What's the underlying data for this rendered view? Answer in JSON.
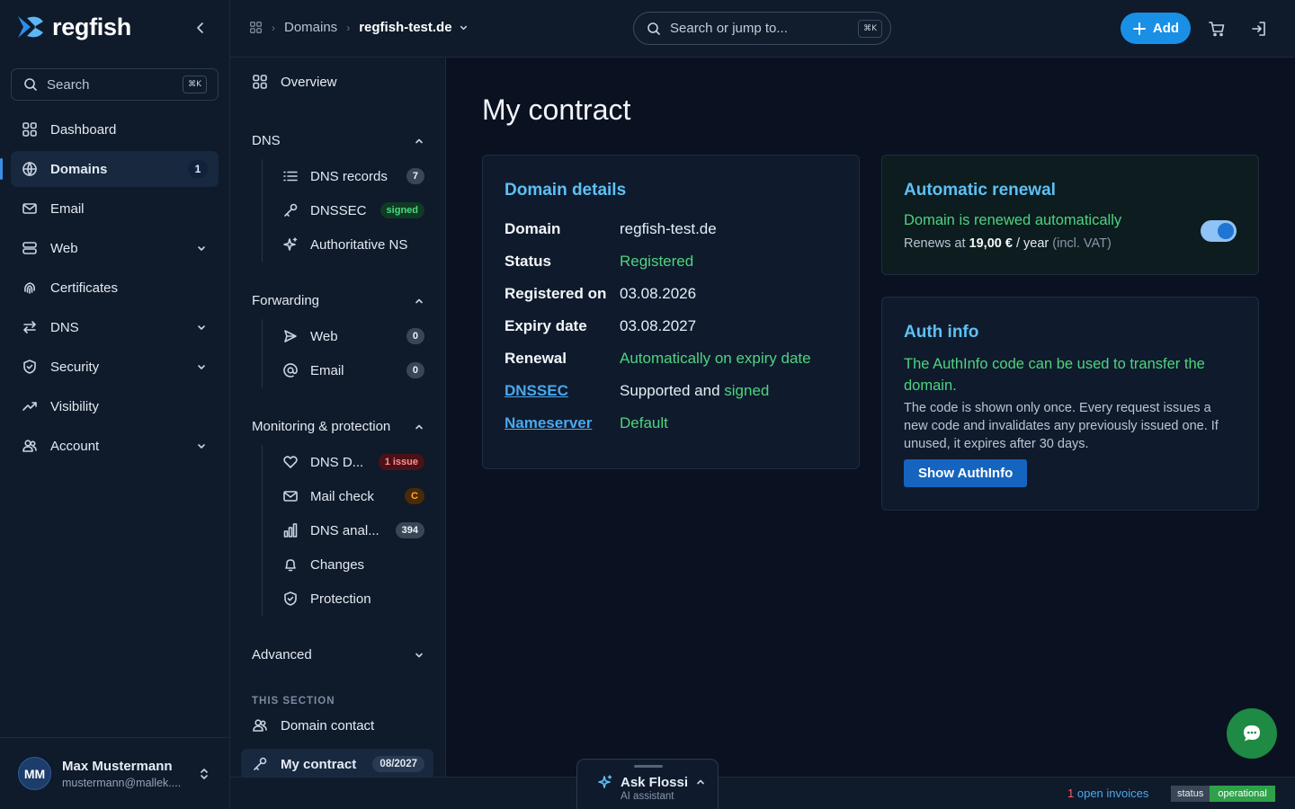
{
  "app": {
    "name": "regfish",
    "brand_color": "#1a8fe6"
  },
  "sidebar": {
    "search": {
      "label": "Search",
      "shortcut": "⌘K"
    },
    "items": [
      {
        "label": "Dashboard",
        "icon": "grid-icon"
      },
      {
        "label": "Domains",
        "icon": "globe-icon",
        "count": "1",
        "active": true
      },
      {
        "label": "Email",
        "icon": "mail-icon"
      },
      {
        "label": "Web",
        "icon": "server-icon",
        "expandable": true
      },
      {
        "label": "Certificates",
        "icon": "fingerprint-icon"
      },
      {
        "label": "DNS",
        "icon": "arrows-icon",
        "expandable": true
      },
      {
        "label": "Security",
        "icon": "shield-icon",
        "expandable": true
      },
      {
        "label": "Visibility",
        "icon": "trend-icon"
      },
      {
        "label": "Account",
        "icon": "users-icon",
        "expandable": true
      }
    ],
    "user": {
      "initials": "MM",
      "name": "Max Mustermann",
      "email": "mustermann@mallek...."
    }
  },
  "topbar": {
    "breadcrumb": [
      "Domains",
      "regfish-test.de"
    ],
    "search_placeholder": "Search or jump to...",
    "search_shortcut": "⌘K",
    "add_label": "Add"
  },
  "subnav": {
    "overview": "Overview",
    "dns": {
      "title": "DNS",
      "items": [
        {
          "label": "DNS records",
          "badge": "7"
        },
        {
          "label": "DNSSEC",
          "badge": "signed"
        },
        {
          "label": "Authoritative NS"
        }
      ]
    },
    "forwarding": {
      "title": "Forwarding",
      "items": [
        {
          "label": "Web",
          "badge": "0"
        },
        {
          "label": "Email",
          "badge": "0"
        }
      ]
    },
    "monitoring": {
      "title": "Monitoring & protection",
      "items": [
        {
          "label": "DNS D...",
          "badge": "1 issue"
        },
        {
          "label": "Mail check",
          "badge": "C"
        },
        {
          "label": "DNS anal...",
          "badge": "394"
        },
        {
          "label": "Changes"
        },
        {
          "label": "Protection"
        }
      ]
    },
    "advanced": {
      "title": "Advanced"
    },
    "this_section": "THIS SECTION",
    "domain_contact": "Domain contact",
    "my_contract": {
      "label": "My contract",
      "badge": "08/2027"
    }
  },
  "main": {
    "title": "My contract",
    "domain_details": {
      "title": "Domain details",
      "rows": [
        {
          "key": "Domain",
          "value": "regfish-test.de"
        },
        {
          "key": "Status",
          "value": "Registered"
        },
        {
          "key": "Registered on",
          "value": "03.08.2026"
        },
        {
          "key": "Expiry date",
          "value": "03.08.2027"
        },
        {
          "key": "Renewal",
          "value": "Automatically on expiry date"
        },
        {
          "key": "DNSSEC",
          "value_prefix": "Supported and ",
          "value_suffix": "signed"
        },
        {
          "key": "Nameserver",
          "value": "Default"
        }
      ]
    },
    "renewal": {
      "title": "Automatic renewal",
      "headline": "Domain is renewed automatically",
      "renews_prefix": "Renews at",
      "price": "19,00 €",
      "per": "/ year",
      "vat": "(incl. VAT)",
      "enabled": true
    },
    "auth": {
      "title": "Auth info",
      "headline": "The AuthInfo code can be used to transfer the domain.",
      "text": "The code is shown only once. Every request issues a new code and invalidates any previously issued one. If unused, it expires after 30 days.",
      "button": "Show AuthInfo"
    }
  },
  "footer": {
    "invoices_count": "1",
    "invoices_label": "open invoices",
    "status_label": "status",
    "status_value": "operational"
  },
  "assistant": {
    "title": "Ask Flossi",
    "subtitle": "AI assistant"
  }
}
